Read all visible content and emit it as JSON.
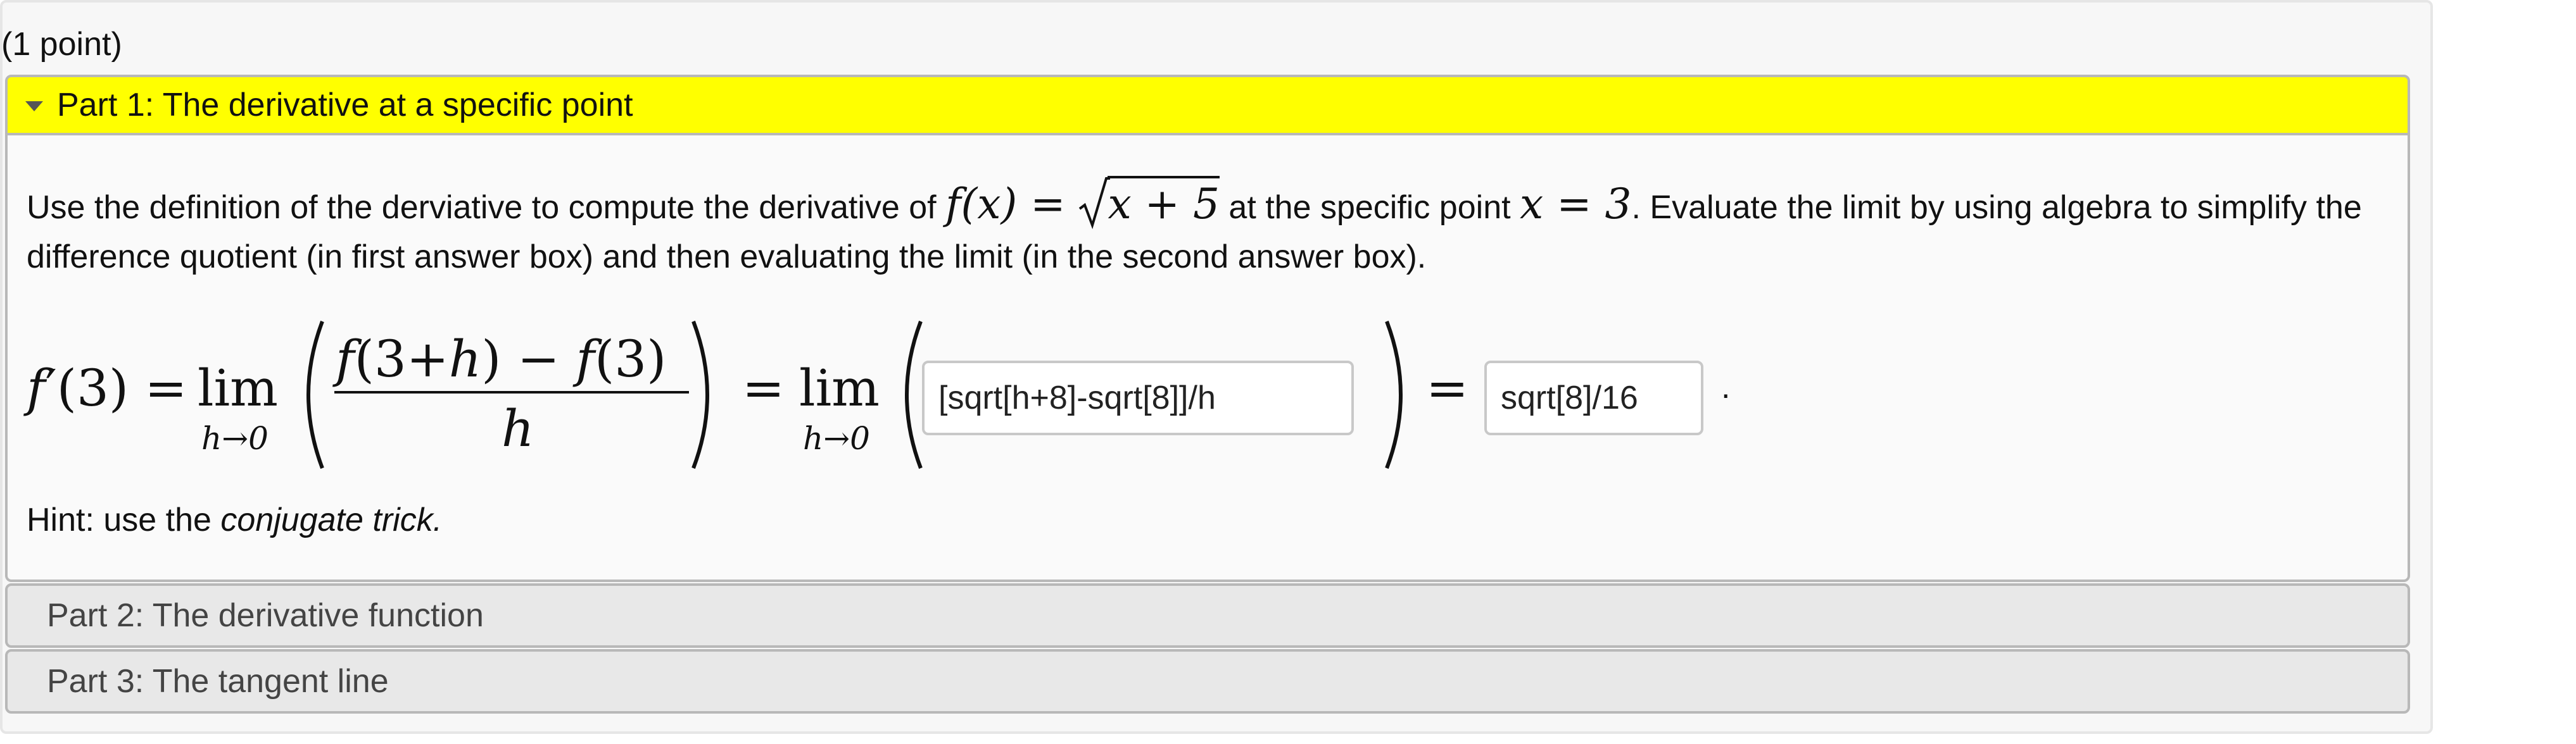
{
  "points_label": "(1 point)",
  "parts": {
    "part1": {
      "title": "Part 1: The derivative at a specific point",
      "text_before": "Use the definition of the derviative to compute the derivative of",
      "text_mid": "at the specific point",
      "text_after": ". Evaluate the limit by using algebra to simplify the difference quotient (in first answer box) and then evaluating the limit (in the second answer box).",
      "math_fx": "f(x) = ",
      "math_radicand": "x + 5",
      "math_point": "x = 3",
      "equation": {
        "lhs": "f′(3) =",
        "lim": "lim",
        "lim_sub": "h→0",
        "numerator": "f(3+h) − f(3)",
        "denominator": "h",
        "equals": "=",
        "equals_final": "=",
        "period": "."
      },
      "answer1_value": "[sqrt[h+8]-sqrt[8]]/h",
      "answer2_value": "sqrt[8]/16",
      "hint_prefix": "Hint: use the",
      "hint_emphasis": "conjugate trick."
    },
    "part2": {
      "title": "Part 2: The derivative function"
    },
    "part3": {
      "title": "Part 3: The tangent line"
    }
  },
  "colors": {
    "open_header": "#ffff00",
    "closed_header": "#e8e8e8",
    "border": "#b8b8b8"
  },
  "icons": {
    "expand": "caret-down-icon",
    "radical": "square-root-icon"
  }
}
